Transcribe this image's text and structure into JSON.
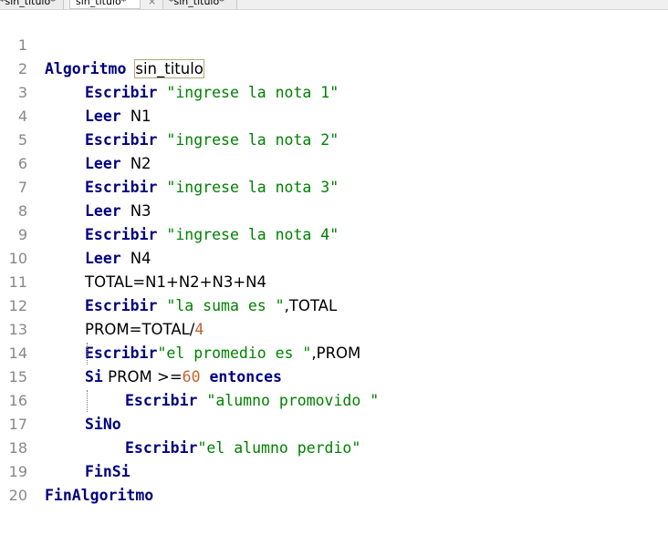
{
  "tabs": [
    {
      "label": "*sin_titulo*"
    },
    {
      "label": "sin_titulo*"
    },
    {
      "label": "×"
    },
    {
      "label": "*sin_titulo*"
    }
  ],
  "editor": {
    "lines": [
      {
        "num": "1"
      },
      {
        "num": "2"
      },
      {
        "num": "3"
      },
      {
        "num": "4"
      },
      {
        "num": "5"
      },
      {
        "num": "6"
      },
      {
        "num": "7"
      },
      {
        "num": "8"
      },
      {
        "num": "9"
      },
      {
        "num": "10"
      },
      {
        "num": "11"
      },
      {
        "num": "12"
      },
      {
        "num": "13"
      },
      {
        "num": "14"
      },
      {
        "num": "15"
      },
      {
        "num": "16"
      },
      {
        "num": "17"
      },
      {
        "num": "18"
      },
      {
        "num": "19"
      },
      {
        "num": "20"
      }
    ],
    "tokens": {
      "l1_kw": "Algoritmo",
      "l1_name": "sin_titulo",
      "escribir": "Escribir",
      "leer": "Leer",
      "l2_str": "\"ingrese la nota 1\"",
      "l3_var": "N1",
      "l4_str": "\"ingrese la nota 2\"",
      "l5_var": "N2",
      "l6_str": "\"ingrese la nota 3\"",
      "l7_var": "N3",
      "l8_str": "\"ingrese la nota 4\"",
      "l9_var": "N4",
      "l10_expr": "TOTAL=N1+N2+N3+N4",
      "l11_str": "\"la suma es \"",
      "l11_rest": ",TOTAL",
      "l12_expr": "PROM=TOTAL/",
      "l12_num": "4",
      "l13_str": "\"el promedio es \"",
      "l13_rest": ",PROM",
      "l14_si": "Si",
      "l14_cond": " PROM >=",
      "l14_num": "60",
      "l14_entonces": "entonces",
      "l15_str": "\"alumno promovido \"",
      "l16_kw": "SiNo",
      "l17_str": "\"el alumno perdio\"",
      "l18_kw": "FinSi",
      "l19_kw": "FinAlgoritmo"
    }
  },
  "colors": {
    "keyword": "#000080",
    "string": "#008000",
    "number": "#c0642f",
    "line_number": "#888888"
  }
}
